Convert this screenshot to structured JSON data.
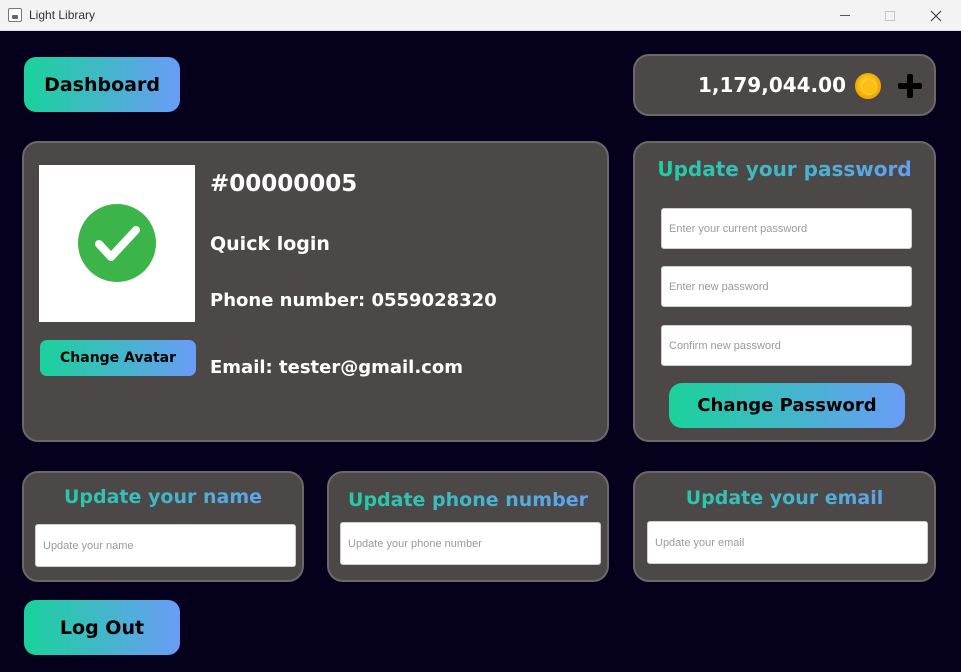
{
  "window": {
    "title": "Light Library"
  },
  "header": {
    "dashboard_label": "Dashboard",
    "balance": "1,179,044.00"
  },
  "profile": {
    "user_id": "#00000005",
    "name": "Quick login",
    "phone": "Phone number: 0559028320",
    "email": "Email: tester@gmail.com",
    "change_avatar_label": "Change Avatar"
  },
  "password_panel": {
    "title": "Update your password",
    "current_placeholder": "Enter your current password",
    "new_placeholder": "Enter new password",
    "confirm_placeholder": "Confirm new password",
    "button_label": "Change Password"
  },
  "name_panel": {
    "title": "Update your name",
    "placeholder": "Update your name"
  },
  "phone_panel": {
    "title": "Update phone number",
    "placeholder": "Update your phone number"
  },
  "email_panel": {
    "title": "Update your email",
    "placeholder": "Update your email"
  },
  "footer": {
    "logout_label": "Log Out"
  },
  "colors": {
    "background": "#05011c",
    "panel": "#4d4848",
    "gradient_start": "#1ad29b",
    "gradient_end": "#6a9cf7"
  }
}
